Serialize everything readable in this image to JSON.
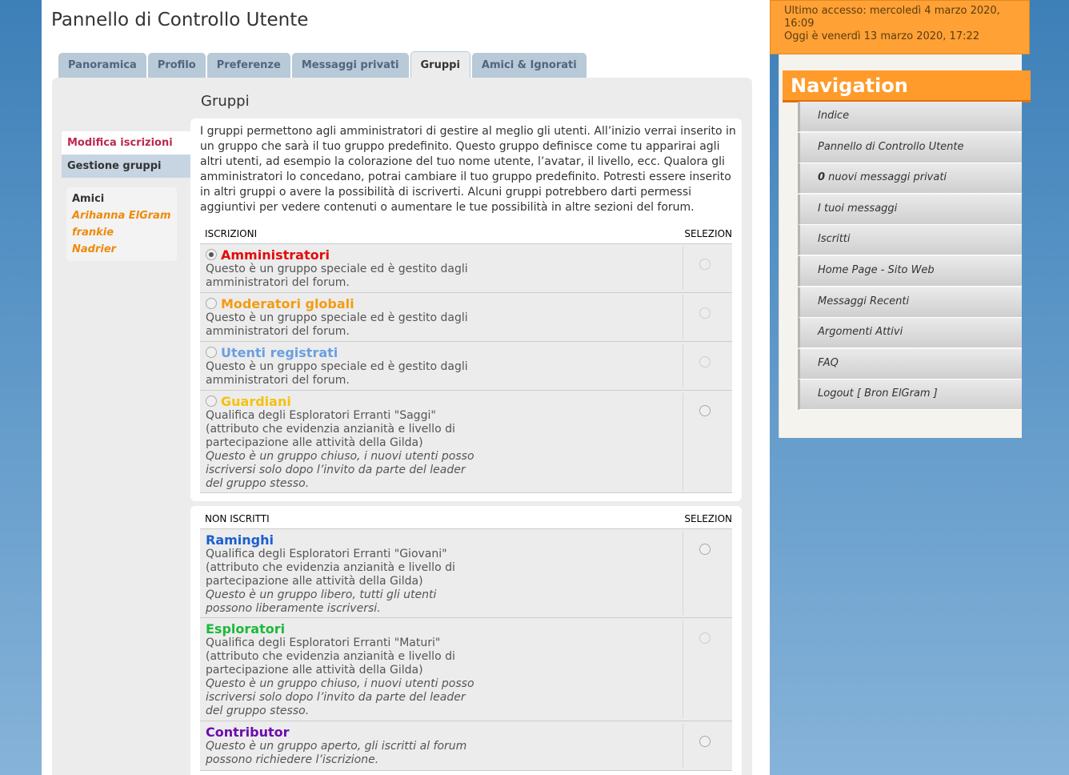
{
  "page_title": "Pannello di Controllo Utente",
  "tabs": [
    {
      "label": "Panoramica"
    },
    {
      "label": "Profilo"
    },
    {
      "label": "Preferenze"
    },
    {
      "label": "Messaggi privati"
    },
    {
      "label": "Gruppi"
    },
    {
      "label": "Amici & Ignorati"
    }
  ],
  "ucp_nav": {
    "current": "Modifica iscrizioni",
    "other": "Gestione gruppi"
  },
  "friends": {
    "title": "Amici",
    "items": [
      "Arihanna ElGram",
      "frankie",
      "Nadrier"
    ]
  },
  "section_title": "Gruppi",
  "intro": "I gruppi permettono agli amministratori di gestire al meglio gli utenti. All’inizio verrai inserito in un gruppo che sarà il tuo gruppo predefinito. Questo gruppo definisce come tu apparirai agli altri utenti, ad esempio la colorazione del tuo nome utente, l’avatar, il livello, ecc. Qualora gli amministratori lo concedano, potrai cambiare il tuo gruppo predefinito. Potresti essere inserito in altri gruppi o avere la possibilità di iscriverti. Alcuni gruppi potrebbero darti permessi aggiuntivi per vedere contenuti o aumentare le tue possibilità in altre sezioni del forum.",
  "memberships": {
    "header_left": "ISCRIZIONI",
    "header_right": "SELEZION",
    "groups": [
      {
        "name": "Amministratori",
        "color": "#e30b0b",
        "desc1": "Questo è un gruppo speciale ed è gestito dagli",
        "desc2": "amministratori del forum."
      },
      {
        "name": "Moderatori globali",
        "color": "#f39c12",
        "desc1": "Questo è un gruppo speciale ed è gestito dagli",
        "desc2": "amministratori del forum."
      },
      {
        "name": "Utenti registrati",
        "color": "#6a9fe0",
        "desc1": "Questo è un gruppo speciale ed è gestito dagli",
        "desc2": "amministratori del forum."
      },
      {
        "name": "Guardiani",
        "color": "#f4c20d",
        "desc1": "Qualifica degli Esploratori Erranti \"Saggi\"",
        "desc2": "(attributo che evidenzia anzianità e livello di",
        "desc3": "partecipazione alle attività della Gilda)",
        "note1": "Questo è un gruppo chiuso, i nuovi utenti posso",
        "note2": "iscriversi solo dopo l’invito da parte del leader",
        "note3": "del gruppo stesso."
      }
    ]
  },
  "non_members": {
    "header_left": "NON ISCRITTI",
    "header_right": "SELEZION",
    "groups": [
      {
        "name": "Raminghi",
        "color": "#1b5ecf",
        "desc1": "Qualifica degli Esploratori Erranti \"Giovani\"",
        "desc2": "(attributo che evidenzia anzianità e livello di",
        "desc3": "partecipazione alle attività della Gilda)",
        "note1": "Questo è un gruppo libero, tutti gli utenti",
        "note2": "possono liberamente iscriversi."
      },
      {
        "name": "Esploratori",
        "color": "#1bba3a",
        "desc1": "Qualifica degli Esploratori Erranti \"Maturi\"",
        "desc2": "(attributo che evidenzia anzianità e livello di",
        "desc3": "partecipazione alle attività della Gilda)",
        "note1": "Questo è un gruppo chiuso, i nuovi utenti posso",
        "note2": "iscriversi solo dopo l’invito da parte del leader",
        "note3": "del gruppo stesso."
      },
      {
        "name": "Contributor",
        "color": "#6a0dad",
        "note1": "Questo è un gruppo aperto, gli iscritti al forum",
        "note2": "possono richiedere l’iscrizione."
      }
    ]
  },
  "access": {
    "line1": "Ultimo accesso: mercoledì 4 marzo 2020,",
    "line2": "16:09",
    "line3": "Oggi è venerdì 13 marzo 2020, 17:22"
  },
  "navigation": {
    "title": "Navigation",
    "links": [
      {
        "label": "Indice"
      },
      {
        "label": "Pannello di Controllo Utente"
      },
      {
        "count": "0",
        "label": " nuovi messaggi privati"
      },
      {
        "label": "I tuoi messaggi"
      },
      {
        "label": "Iscritti"
      },
      {
        "label": "Home Page - Sito Web"
      },
      {
        "label": "Messaggi Recenti"
      },
      {
        "label": "Argomenti Attivi"
      },
      {
        "label": "FAQ"
      },
      {
        "label": "Logout [ Bron ElGram ]"
      }
    ]
  }
}
